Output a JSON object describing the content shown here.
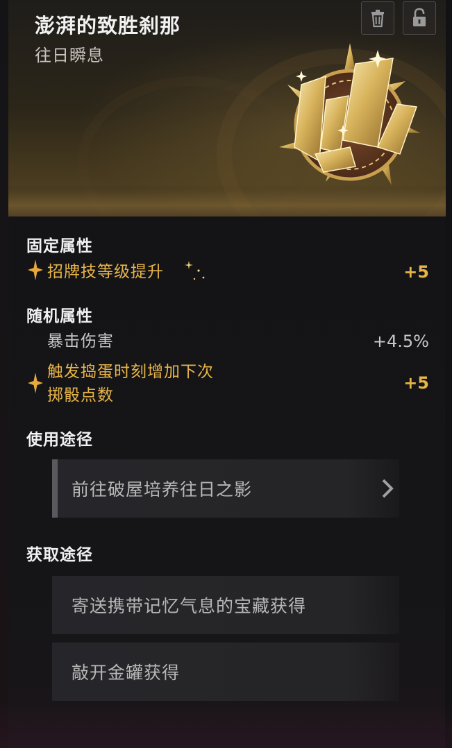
{
  "item": {
    "title": "澎湃的致胜刹那",
    "subtitle": "往日瞬息",
    "emblem_icon": "gold-shard-emblem"
  },
  "header_buttons": {
    "delete_icon": "trash-icon",
    "lock_icon": "lock-icon"
  },
  "fixed_attributes": {
    "heading": "固定属性",
    "items": [
      {
        "label": "招牌技等级提升",
        "value": "+5",
        "highlight": true
      }
    ]
  },
  "random_attributes": {
    "heading": "随机属性",
    "items": [
      {
        "label": "暴击伤害",
        "value": "+4.5%",
        "highlight": false
      },
      {
        "label_line1": "触发捣蛋时刻增加下次",
        "label_line2": "掷骰点数",
        "value": "+5",
        "highlight": true
      }
    ]
  },
  "usage": {
    "heading": "使用途径",
    "routes": [
      {
        "label": "前往破屋培养往日之影"
      }
    ]
  },
  "acquire": {
    "heading": "获取途径",
    "routes": [
      {
        "label": "寄送携带记忆气息的宝藏获得"
      },
      {
        "label": "敲开金罐获得"
      }
    ]
  },
  "colors": {
    "accent_gold": "#e7b448",
    "background": "#141416",
    "panel": "#252528"
  }
}
